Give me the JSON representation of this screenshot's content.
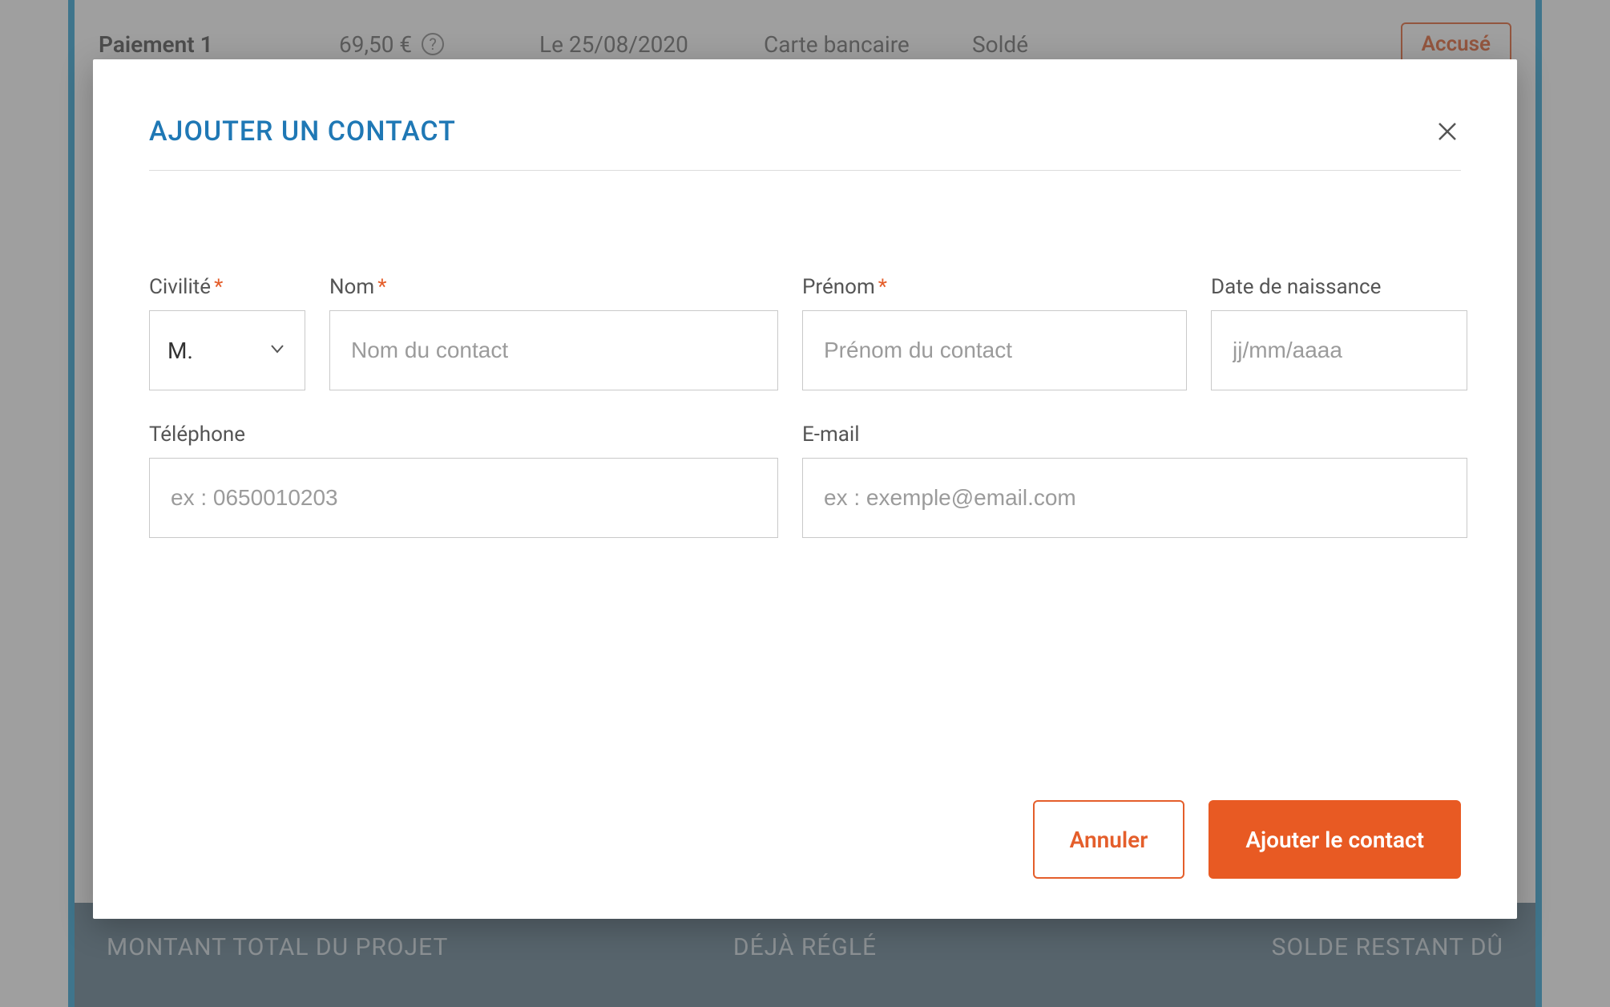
{
  "background": {
    "payment_row": {
      "label": "Paiement 1",
      "amount": "69,50 €",
      "date": "Le 25/08/2020",
      "method": "Carte bancaire",
      "status": "Soldé",
      "action": "Accusé"
    },
    "footer": {
      "total": "MONTANT TOTAL DU PROJET",
      "paid": "DÉJÀ RÉGLÉ",
      "remaining": "SOLDE RESTANT DÛ"
    }
  },
  "modal": {
    "title": "AJOUTER UN CONTACT",
    "fields": {
      "civility": {
        "label": "Civilité",
        "value": "M.",
        "required": true
      },
      "lastname": {
        "label": "Nom",
        "placeholder": "Nom du contact",
        "required": true
      },
      "firstname": {
        "label": "Prénom",
        "placeholder": "Prénom du contact",
        "required": true
      },
      "dob": {
        "label": "Date de naissance",
        "placeholder": "jj/mm/aaaa",
        "required": false
      },
      "phone": {
        "label": "Téléphone",
        "placeholder": "ex : 0650010203",
        "required": false
      },
      "email": {
        "label": "E-mail",
        "placeholder": "ex : exemple@email.com",
        "required": false
      }
    },
    "buttons": {
      "cancel": "Annuler",
      "submit": "Ajouter le contact"
    },
    "required_marker": "*"
  }
}
